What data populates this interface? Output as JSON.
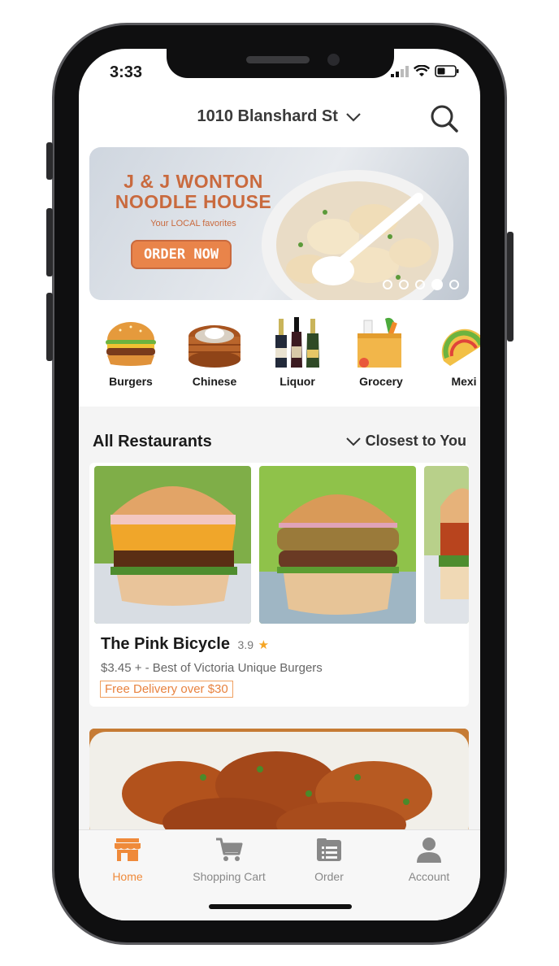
{
  "status": {
    "time": "3:33"
  },
  "header": {
    "address": "1010 Blanshard St"
  },
  "banner": {
    "title_line1": "J & J WONTON",
    "title_line2": "NOODLE HOUSE",
    "subtitle": "Your LOCAL favorites",
    "cta": "ORDER NOW",
    "slides": 5,
    "active_slide": 4
  },
  "categories": [
    {
      "label": "Burgers",
      "icon": "burger-icon"
    },
    {
      "label": "Chinese",
      "icon": "dumpling-basket-icon"
    },
    {
      "label": "Liquor",
      "icon": "bottles-icon"
    },
    {
      "label": "Grocery",
      "icon": "grocery-bag-icon"
    },
    {
      "label": "Mexi",
      "icon": "taco-icon"
    }
  ],
  "section": {
    "title": "All Restaurants",
    "sort": "Closest to You"
  },
  "restaurant": {
    "name": "The Pink Bicycle",
    "rating": "3.9",
    "description": "$3.45 + - Best of Victoria Unique Burgers",
    "promo": "Free Delivery over $30"
  },
  "tabs": [
    {
      "label": "Home",
      "icon": "store-icon",
      "active": true
    },
    {
      "label": "Shopping Cart",
      "icon": "cart-icon",
      "active": false
    },
    {
      "label": "Order",
      "icon": "order-list-icon",
      "active": false
    },
    {
      "label": "Account",
      "icon": "person-icon",
      "active": false
    }
  ],
  "colors": {
    "accent": "#ef8a3a",
    "banner_text": "#c96a3e"
  }
}
